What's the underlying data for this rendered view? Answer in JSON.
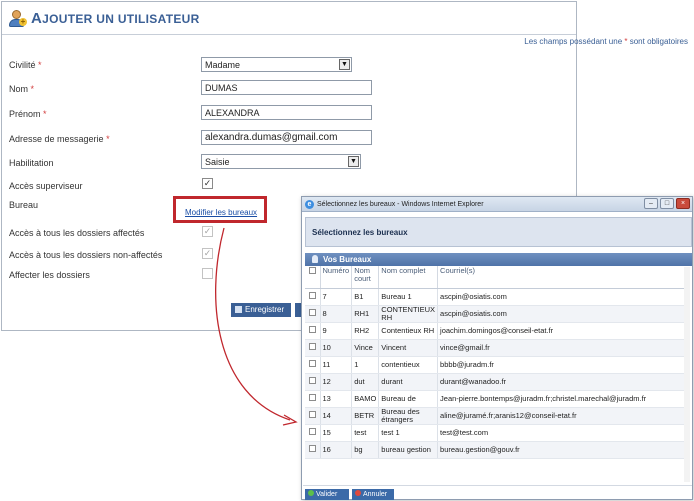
{
  "form": {
    "title_first": "A",
    "title_rest": "JOUTER UN UTILISATEUR",
    "required_note_before": "Les champs possédant une",
    "required_star": "*",
    "required_note_after": "sont obligatoires",
    "civilite_label": "Civilité",
    "civilite_value": "Madame",
    "nom_label": "Nom",
    "nom_value": "DUMAS",
    "prenom_label": "Prénom",
    "prenom_value": "ALEXANDRA",
    "email_label": "Adresse de messagerie",
    "email_value": "alexandra.dumas@gmail.com",
    "habilitation_label": "Habilitation",
    "habilitation_value": "Saisie",
    "superviseur_label": "Accès superviseur",
    "superviseur_checked": true,
    "bureau_label": "Bureau",
    "bureau_link": "Modifier les bureaux",
    "affectes_label": "Accès à tous les dossiers affectés",
    "affectes_checked": true,
    "non_affectes_label": "Accès à tous les dossiers non-affectés",
    "non_affectes_checked": true,
    "affecter_label": "Affecter les dossiers",
    "affecter_checked": false,
    "save_label": "Enregistrer",
    "check_glyph": "✓",
    "select_arrow": "▼"
  },
  "dialog": {
    "window_title": "Sélectionnez les bureaux - Windows Internet Explorer",
    "heading": "Sélectionnez les bureaux",
    "section_title": "Vos Bureaux",
    "columns": [
      "Numéro",
      "Nom court",
      "Nom complet",
      "Courriel(s)"
    ],
    "rows": [
      {
        "num": "7",
        "court": "B1",
        "complet": "Bureau 1",
        "courriel": "ascpin@osiatis.com"
      },
      {
        "num": "8",
        "court": "RH1",
        "complet": "CONTENTIEUX RH",
        "courriel": "ascpin@osiatis.com"
      },
      {
        "num": "9",
        "court": "RH2",
        "complet": "Contentieux RH",
        "courriel": "joachim.domingos@conseil-etat.fr"
      },
      {
        "num": "10",
        "court": "Vince",
        "complet": "Vincent",
        "courriel": "vince@gmail.fr"
      },
      {
        "num": "11",
        "court": "1",
        "complet": "contentieux",
        "courriel": "bbbb@juradm.fr"
      },
      {
        "num": "12",
        "court": "dut",
        "complet": "durant",
        "courriel": "durant@wanadoo.fr"
      },
      {
        "num": "13",
        "court": "BAMO",
        "complet": "Bureau de",
        "courriel": "Jean-pierre.bontemps@juradm.fr;christel.marechal@juradm.fr"
      },
      {
        "num": "14",
        "court": "BETR",
        "complet": "Bureau des étrangers",
        "courriel": "aline@juramé.fr;aranis12@conseil-etat.fr"
      },
      {
        "num": "15",
        "court": "test",
        "complet": "test 1",
        "courriel": "test@test.com"
      },
      {
        "num": "16",
        "court": "bg",
        "complet": "bureau gestion",
        "courriel": "bureau.gestion@gouv.fr"
      }
    ],
    "valider_label": "Valider",
    "annuler_label": "Annuler",
    "min_glyph": "–",
    "max_glyph": "□",
    "close_glyph": "×",
    "ie_glyph": "e"
  },
  "colors": {
    "accent": "#3a5f95",
    "required": "#d23c3c",
    "highlight": "#c0272d"
  }
}
